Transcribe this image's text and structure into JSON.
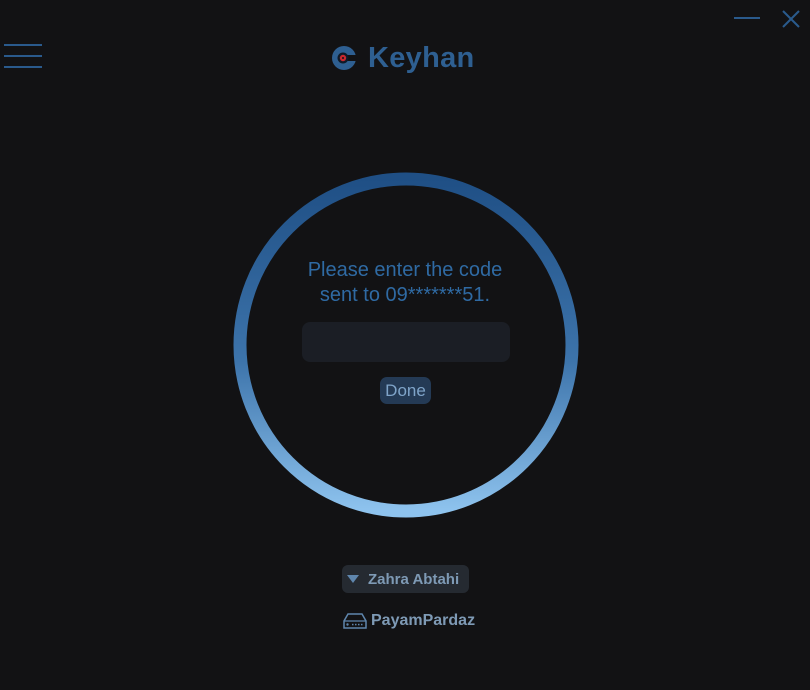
{
  "app": {
    "name": "Keyhan"
  },
  "window_controls": {
    "minimize_icon": "minimize-icon",
    "close_icon": "close-icon"
  },
  "menu": {
    "icon": "hamburger-menu-icon"
  },
  "verification": {
    "prompt_line1": "Please enter the code",
    "prompt_line2": "sent to 09*******51.",
    "code_value": "",
    "code_placeholder": "",
    "done_label": "Done"
  },
  "user": {
    "name": "Zahra Abtahi",
    "icon": "caret-down-icon"
  },
  "organization": {
    "name": "PayamPardaz",
    "icon": "server-icon"
  },
  "colors": {
    "background": "#121214",
    "accent": "#2e5f91",
    "ring_top": "#1f4f85",
    "ring_bottom": "#8ec3ee",
    "text_muted": "#7e9ab5"
  }
}
